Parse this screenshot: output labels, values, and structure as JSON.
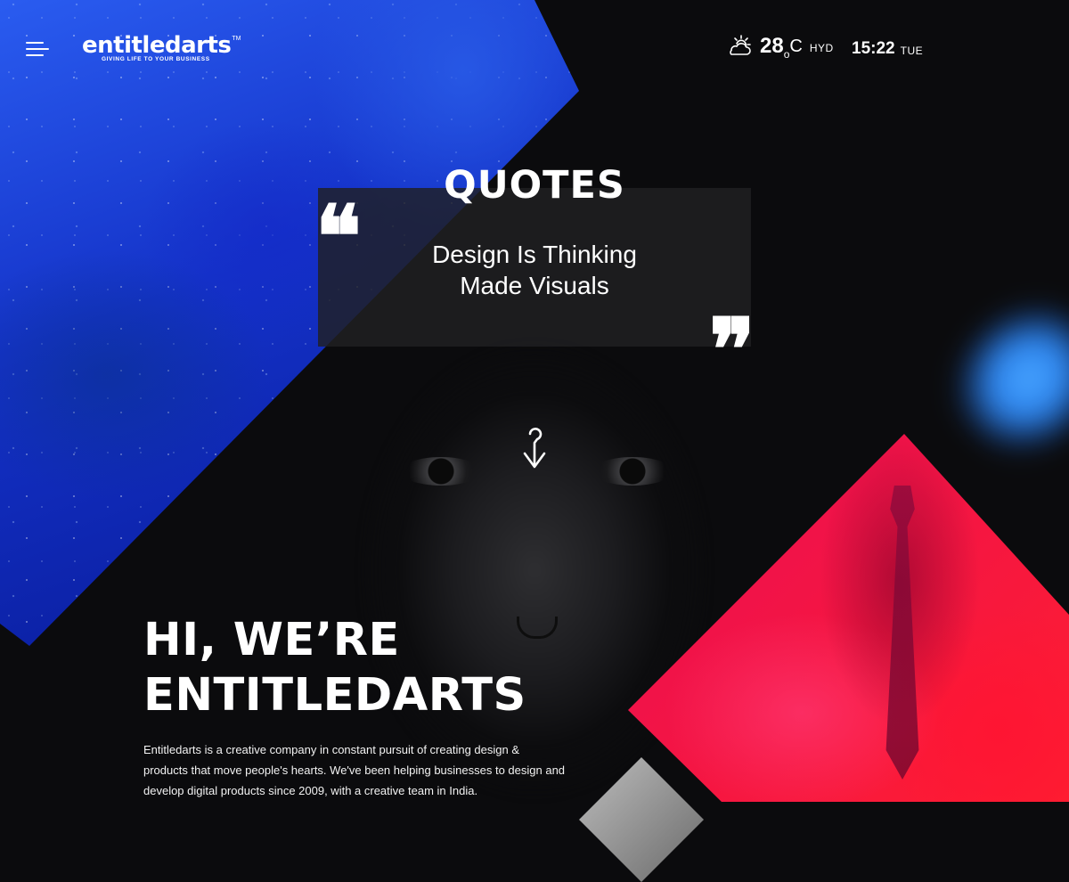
{
  "header": {
    "logo_text": "entitledarts",
    "logo_tm": "TM",
    "logo_tagline": "GIVING LIFE TO YOUR BUSINESS",
    "menu_icon": "hamburger-icon",
    "weather": {
      "icon": "partly-cloudy-icon",
      "temperature": "28",
      "degree_symbol": "o",
      "unit": "C",
      "city": "HYD"
    },
    "clock": {
      "time": "15:22",
      "day": "TUE"
    }
  },
  "quotes": {
    "title": "QUOTES",
    "line1": "Design Is Thinking",
    "line2": "Made Visuals",
    "open_mark": "❝",
    "close_mark": "❞",
    "scroll_icon": "scroll-down-arrow-icon"
  },
  "intro": {
    "heading_line1": "HI, WE’RE",
    "heading_line2": "ENTITLEDARTS",
    "body_line1": "Entitledarts is a creative company in constant pursuit of creating design &",
    "body_line2": "products that move people's hearts. We've been helping businesses to design and",
    "body_line3": "develop digital products since 2009, with a creative team in India."
  },
  "colors": {
    "background": "#0b0b0d",
    "blue_accent": "#1432c8",
    "pink_accent": "#e8136c",
    "text": "#ffffff"
  }
}
